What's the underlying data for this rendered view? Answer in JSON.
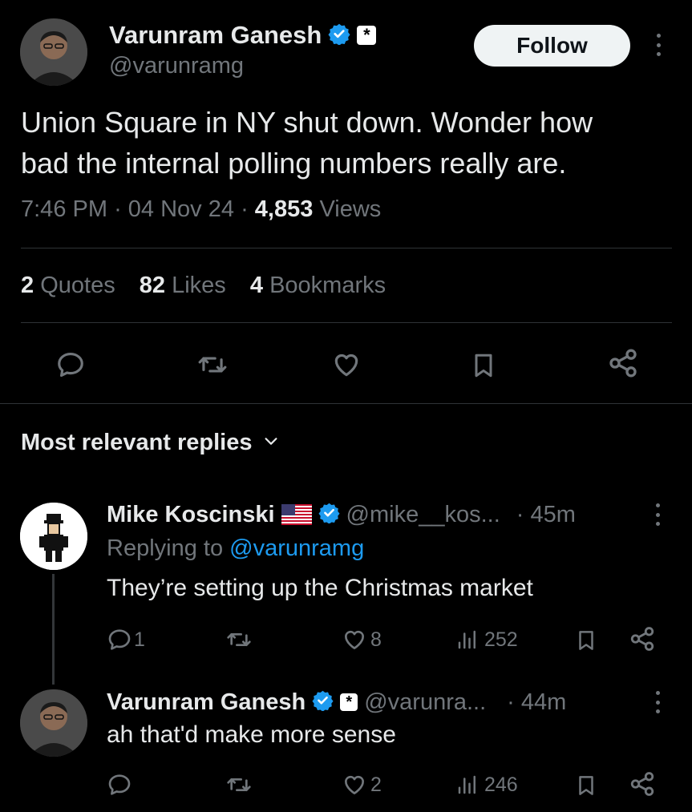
{
  "tweet": {
    "author_name": "Varunram Ganesh",
    "author_handle": "@varunramg",
    "affiliation_badge": "*",
    "follow_label": "Follow",
    "text_line1": "Union Square in NY shut down. Wonder how",
    "text_line2": "bad the internal polling numbers really are.",
    "time": "7:46 PM",
    "date": "04 Nov 24",
    "views_count": "4,853",
    "views_label": "Views",
    "separator": "·",
    "quotes_count": "2",
    "quotes_label": "Quotes",
    "likes_count": "82",
    "likes_label": "Likes",
    "bookmarks_count": "4",
    "bookmarks_label": "Bookmarks"
  },
  "replies_header": {
    "label": "Most relevant replies"
  },
  "replies": [
    {
      "author_name": "Mike Koscinski",
      "handle": "@mike__kos...",
      "time": "· 45m",
      "replying_prefix": "Replying to",
      "replying_to": "@varunramg",
      "text": "They’re setting up the Christmas market",
      "reply_count": "1",
      "like_count": "8",
      "view_count": "252"
    },
    {
      "author_name": "Varunram Ganesh",
      "handle": "@varunra...",
      "time": "· 44m",
      "affiliation_badge": "*",
      "text": "ah that'd make more sense",
      "like_count": "2",
      "view_count": "246"
    }
  ],
  "colors": {
    "background": "#000000",
    "text": "#e7e9ea",
    "muted": "#71767b",
    "accent": "#1d9bf0",
    "divider": "#2f3336"
  },
  "icons": [
    "verified-badge-icon",
    "reply-icon",
    "retweet-icon",
    "like-icon",
    "bookmark-icon",
    "share-icon",
    "views-icon",
    "more-icon",
    "chevron-down-icon",
    "us-flag-icon"
  ]
}
